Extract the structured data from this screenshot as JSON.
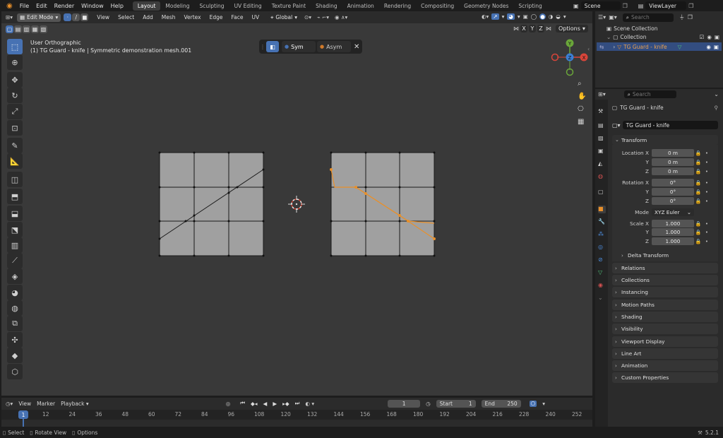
{
  "menu": [
    "File",
    "Edit",
    "Render",
    "Window",
    "Help"
  ],
  "workspaces": [
    "Layout",
    "Modeling",
    "Sculpting",
    "UV Editing",
    "Texture Paint",
    "Shading",
    "Animation",
    "Rendering",
    "Compositing",
    "Geometry Nodes",
    "Scripting"
  ],
  "active_workspace": "Layout",
  "scene": "Scene",
  "view_layer": "ViewLayer",
  "header": {
    "mode": "Edit Mode",
    "view": "View",
    "select": "Select",
    "add": "Add",
    "mesh": "Mesh",
    "vertex": "Vertex",
    "edge": "Edge",
    "face": "Face",
    "uv": "UV",
    "orientation": "Global",
    "options": "Options",
    "axes": [
      "X",
      "Y",
      "Z"
    ]
  },
  "viewport": {
    "line1": "User Orthographic",
    "line2": "(1) TG Guard - knife | Symmetric demonstration mesh.001",
    "popup": {
      "sym": "Sym",
      "asym": "Asym",
      "sym_color": "#4772b3",
      "asym_color": "#d07a2a"
    },
    "gizmo": {
      "x": "X",
      "y": "Y",
      "z": "Z"
    }
  },
  "outliner": {
    "search_placeholder": "Search",
    "scene_collection": "Scene Collection",
    "collection": "Collection",
    "object": "TG Guard - knife"
  },
  "properties": {
    "search_placeholder": "Search",
    "object_name": "TG Guard - knife",
    "datablock": "TG Guard - knife",
    "transform": "Transform",
    "location_label": "Location X",
    "y": "Y",
    "z": "Z",
    "location": [
      "0 m",
      "0 m",
      "0 m"
    ],
    "rotation_label": "Rotation X",
    "rotation": [
      "0°",
      "0°",
      "0°"
    ],
    "mode_label": "Mode",
    "mode": "XYZ Euler",
    "scale_label": "Scale X",
    "scale": [
      "1.000",
      "1.000",
      "1.000"
    ],
    "delta": "Delta Transform",
    "sections": [
      "Relations",
      "Collections",
      "Instancing",
      "Motion Paths",
      "Shading",
      "Visibility",
      "Viewport Display",
      "Line Art",
      "Animation",
      "Custom Properties"
    ]
  },
  "timeline": {
    "view": "View",
    "marker": "Marker",
    "playback": "Playback",
    "frame": "1",
    "start_label": "Start",
    "start": "1",
    "end_label": "End",
    "end": "250",
    "current": "1",
    "ticks": [
      "12",
      "24",
      "36",
      "48",
      "60",
      "72",
      "84",
      "96",
      "108",
      "120",
      "132",
      "144",
      "156",
      "168",
      "180",
      "192",
      "204",
      "216",
      "228",
      "240",
      "252"
    ]
  },
  "status": {
    "select": "Select",
    "rotate": "Rotate View",
    "options": "Options",
    "version": "5.2.1"
  },
  "colors": {
    "accent": "#4772b3",
    "orange": "#e8902b",
    "mesh": "#a0a0a0"
  }
}
